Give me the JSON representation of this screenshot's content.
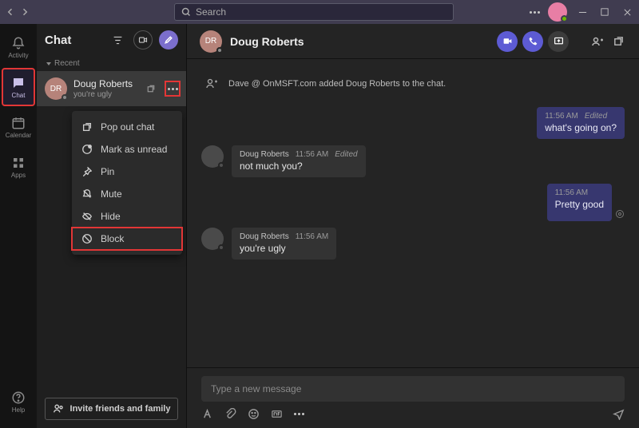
{
  "search": {
    "placeholder": "Search"
  },
  "rail": {
    "activity": "Activity",
    "chat": "Chat",
    "calendar": "Calendar",
    "apps": "Apps",
    "help": "Help"
  },
  "sidebar": {
    "title": "Chat",
    "section": "Recent",
    "item": {
      "initials": "DR",
      "name": "Doug Roberts",
      "preview": "you're ugly"
    },
    "menu": {
      "popout": "Pop out chat",
      "unread": "Mark as unread",
      "pin": "Pin",
      "mute": "Mute",
      "hide": "Hide",
      "block": "Block"
    },
    "invite": "Invite friends and family"
  },
  "chat": {
    "initials": "DR",
    "name": "Doug Roberts",
    "system": "Dave @ OnMSFT.com added Doug Roberts to the chat.",
    "messages": [
      {
        "side": "right",
        "time": "11:56 AM",
        "edited": "Edited",
        "body": "what's going on?"
      },
      {
        "side": "left",
        "sender": "Doug Roberts",
        "time": "11:56 AM",
        "edited": "Edited",
        "body": "not much you?"
      },
      {
        "side": "right",
        "time": "11:56 AM",
        "body": "Pretty good"
      },
      {
        "side": "left",
        "sender": "Doug Roberts",
        "time": "11:56 AM",
        "body": "you're ugly"
      }
    ],
    "compose": {
      "placeholder": "Type a new message"
    }
  }
}
